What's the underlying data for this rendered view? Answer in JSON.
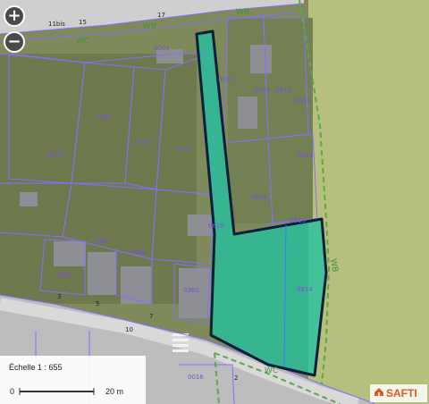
{
  "map": {
    "parcel_labels": [
      "0005",
      "0615",
      "0003",
      "0610",
      "0611",
      "0378",
      "0359",
      "0377",
      "0009",
      "0612",
      "0616",
      "0613",
      "0618",
      "0382",
      "0381",
      "0008",
      "0360",
      "0614",
      "0016"
    ],
    "road_labels": [
      "WB",
      "WC",
      "WB",
      "WB",
      "WC"
    ],
    "street_numbers": [
      "11bis",
      "15",
      "17",
      "3",
      "5",
      "7",
      "10",
      "2"
    ],
    "colors": {
      "selection_fill": "#22c1a0",
      "selection_stroke": "#0b1f3a",
      "parcel_line": "#8a6cff",
      "road_line": "#5aa84a"
    }
  },
  "controls": {
    "zoom_in": "+",
    "zoom_out": "−"
  },
  "scale": {
    "label": "Échelle 1 : 655",
    "start": "0",
    "end": "20 m"
  },
  "brand": {
    "name": "SAFTI",
    "icon": "house-icon"
  }
}
